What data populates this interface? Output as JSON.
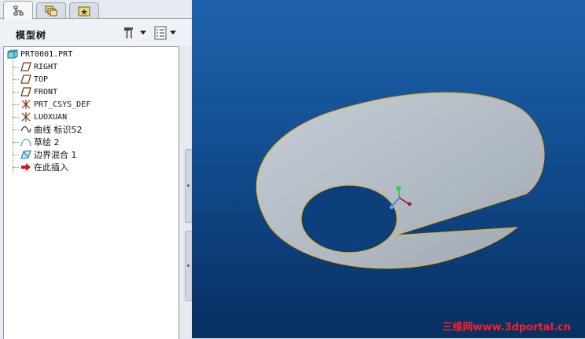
{
  "tabs": [
    {
      "name": "model-tree-tab",
      "icon": "tree-icon"
    },
    {
      "name": "folder-browser-tab",
      "icon": "folders-icon"
    },
    {
      "name": "favorites-tab",
      "icon": "favorites-icon"
    }
  ],
  "tree_header": {
    "title": "模型树",
    "settings_icon": "tools-icon",
    "show_icon": "list-icon"
  },
  "tree": {
    "root": "PRT0001.PRT",
    "items": [
      {
        "label": "RIGHT",
        "icon": "datum-plane-icon"
      },
      {
        "label": "TOP",
        "icon": "datum-plane-icon"
      },
      {
        "label": "FRONT",
        "icon": "datum-plane-icon"
      },
      {
        "label": "PRT_CSYS_DEF",
        "icon": "coordinate-system-icon"
      },
      {
        "label": "LUOXUAN",
        "icon": "coordinate-system-icon"
      },
      {
        "label": "曲线 标识52",
        "icon": "curve-icon"
      },
      {
        "label": "草绘 2",
        "icon": "sketch-icon"
      },
      {
        "label": "边界混合 1",
        "icon": "boundary-blend-icon"
      },
      {
        "label": "在此插入",
        "icon": "insert-here-arrow-icon"
      }
    ]
  },
  "colors": {
    "viewport_top": "#1f63ad",
    "viewport_bottom": "#072f62",
    "surface_fill": "#b6bfc8",
    "surface_edge": "#e0b030",
    "watermark": "#ff2020"
  },
  "watermark": "三维网www.3dportal.cn"
}
